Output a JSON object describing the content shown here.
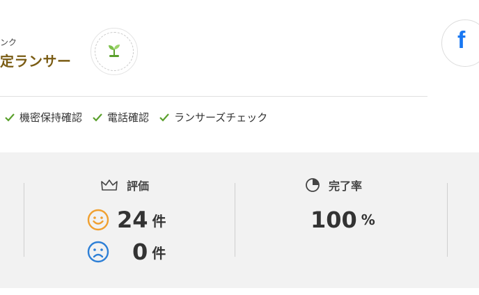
{
  "profile": {
    "rank_label_partial": "ンク",
    "rank_title_partial": "定ランサー",
    "badge_icon": "sprout-icon",
    "facebook_icon": "facebook-icon",
    "facebook_glyph": "f"
  },
  "verifications": [
    {
      "label": "機密保持確認",
      "icon": "check-icon"
    },
    {
      "label": "電話確認",
      "icon": "check-icon"
    },
    {
      "label": "ランサーズチェック",
      "icon": "check-icon"
    }
  ],
  "stats": {
    "rating": {
      "title": "評価",
      "icon": "crown-icon",
      "good": {
        "value": "24",
        "unit": "件",
        "icon": "smile-icon"
      },
      "bad": {
        "value": "0",
        "unit": "件",
        "icon": "sad-icon"
      }
    },
    "completion": {
      "title": "完了率",
      "icon": "pie-chart-icon",
      "value": "100",
      "unit": "%"
    }
  },
  "colors": {
    "rank_title": "#7a5c14",
    "check": "#5aa02c",
    "smile": "#f0a030",
    "sad": "#2d7fd6",
    "facebook": "#1877f2",
    "panel_bg": "#f2f2f2"
  }
}
